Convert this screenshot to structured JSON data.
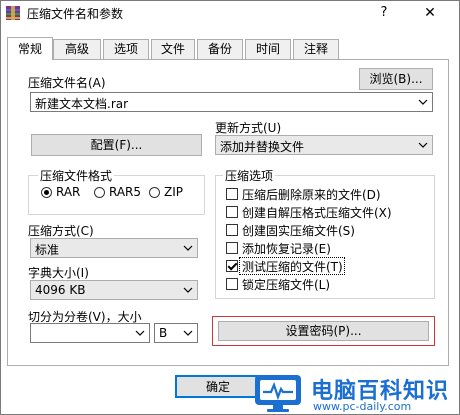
{
  "window": {
    "title": "压缩文件名和参数",
    "help": "?",
    "close": "✕"
  },
  "tabs": [
    "常规",
    "高级",
    "选项",
    "文件",
    "备份",
    "时间",
    "注释"
  ],
  "archive_name": {
    "label": "压缩文件名(A)",
    "browse": "浏览(B)...",
    "value": "新建文本文档.rar"
  },
  "profiles_button": "配置(F)...",
  "update_mode": {
    "label": "更新方式(U)",
    "value": "添加并替换文件"
  },
  "format": {
    "title": "压缩文件格式",
    "options": [
      "RAR",
      "RAR5",
      "ZIP"
    ],
    "selected": "RAR"
  },
  "options": {
    "title": "压缩选项",
    "items": [
      {
        "label": "压缩后删除原来的文件(D)",
        "checked": false
      },
      {
        "label": "创建自解压格式压缩文件(X)",
        "checked": false
      },
      {
        "label": "创建固实压缩文件(S)",
        "checked": false
      },
      {
        "label": "添加恢复记录(E)",
        "checked": false
      },
      {
        "label": "测试压缩的文件(T)",
        "checked": true
      },
      {
        "label": "锁定压缩文件(L)",
        "checked": false
      }
    ]
  },
  "method": {
    "label": "压缩方式(C)",
    "value": "标准"
  },
  "dictionary": {
    "label": "字典大小(I)",
    "value": "4096 KB"
  },
  "split": {
    "label": "切分为分卷(V)，大小",
    "value": "",
    "unit": "B"
  },
  "set_password": "设置密码(P)...",
  "footer": {
    "ok": "确定"
  },
  "watermark": {
    "text": "电脑百科知识",
    "url": "www.pc-daily.com"
  }
}
